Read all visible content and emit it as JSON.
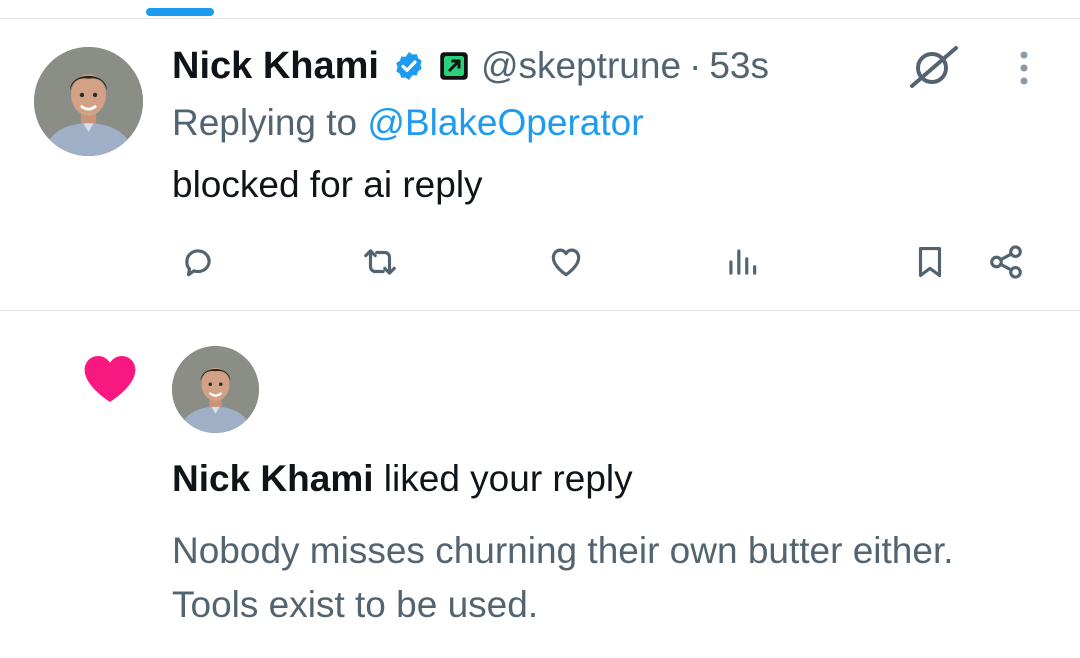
{
  "tweet": {
    "author_name": "Nick Khami",
    "handle": "@skeptrune",
    "separator": "·",
    "time": "53s",
    "replying_prefix": "Replying to",
    "replying_to": "@BlakeOperator",
    "text": "blocked for ai reply"
  },
  "actions": {
    "icons": [
      "reply-icon",
      "retweet-icon",
      "like-icon",
      "views-icon",
      "bookmark-icon",
      "share-icon"
    ]
  },
  "notification": {
    "liker": "Nick Khami",
    "action_text": "liked your reply",
    "reply_text": "Nobody misses churning their own butter either. Tools exist to be used."
  },
  "colors": {
    "accent": "#1d9bf0",
    "secondary_text": "#536471",
    "like_pink": "#f91880",
    "icon_gray": "#536471"
  }
}
